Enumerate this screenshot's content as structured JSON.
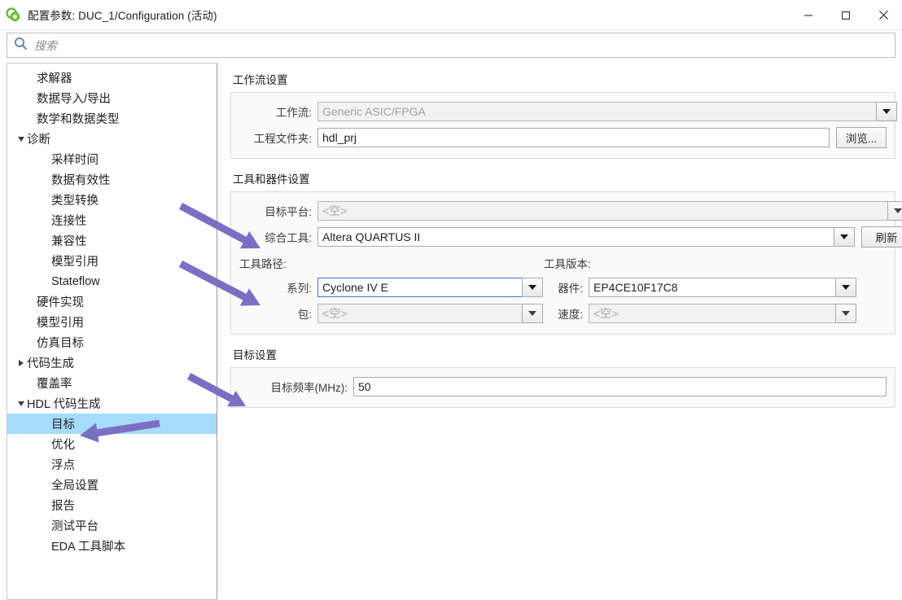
{
  "window": {
    "title": "配置参数: DUC_1/Configuration (活动)",
    "icon": "simulink-icon",
    "minimize": "minimize-icon",
    "maximize": "maximize-icon",
    "close": "close-icon"
  },
  "search": {
    "icon": "search-icon",
    "placeholder": "搜索",
    "value": ""
  },
  "sidebar": {
    "items": [
      {
        "label": "求解器",
        "indent": 1,
        "twisty": "none",
        "selected": false
      },
      {
        "label": "数据导入/导出",
        "indent": 1,
        "twisty": "none",
        "selected": false
      },
      {
        "label": "数学和数据类型",
        "indent": 1,
        "twisty": "none",
        "selected": false
      },
      {
        "label": "诊断",
        "indent": 0,
        "twisty": "expanded",
        "selected": false
      },
      {
        "label": "采样时间",
        "indent": 2,
        "twisty": "none",
        "selected": false
      },
      {
        "label": "数据有效性",
        "indent": 2,
        "twisty": "none",
        "selected": false
      },
      {
        "label": "类型转换",
        "indent": 2,
        "twisty": "none",
        "selected": false
      },
      {
        "label": "连接性",
        "indent": 2,
        "twisty": "none",
        "selected": false
      },
      {
        "label": "兼容性",
        "indent": 2,
        "twisty": "none",
        "selected": false
      },
      {
        "label": "模型引用",
        "indent": 2,
        "twisty": "none",
        "selected": false
      },
      {
        "label": "Stateflow",
        "indent": 2,
        "twisty": "none",
        "selected": false
      },
      {
        "label": "硬件实现",
        "indent": 1,
        "twisty": "none",
        "selected": false
      },
      {
        "label": "模型引用",
        "indent": 1,
        "twisty": "none",
        "selected": false
      },
      {
        "label": "仿真目标",
        "indent": 1,
        "twisty": "none",
        "selected": false
      },
      {
        "label": "代码生成",
        "indent": 0,
        "twisty": "collapsed",
        "selected": false
      },
      {
        "label": "覆盖率",
        "indent": 1,
        "twisty": "none",
        "selected": false
      },
      {
        "label": "HDL 代码生成",
        "indent": 0,
        "twisty": "expanded",
        "selected": false
      },
      {
        "label": "目标",
        "indent": 2,
        "twisty": "none",
        "selected": true
      },
      {
        "label": "优化",
        "indent": 2,
        "twisty": "none",
        "selected": false
      },
      {
        "label": "浮点",
        "indent": 2,
        "twisty": "none",
        "selected": false
      },
      {
        "label": "全局设置",
        "indent": 2,
        "twisty": "none",
        "selected": false
      },
      {
        "label": "报告",
        "indent": 2,
        "twisty": "none",
        "selected": false
      },
      {
        "label": "测试平台",
        "indent": 2,
        "twisty": "none",
        "selected": false
      },
      {
        "label": "EDA 工具脚本",
        "indent": 2,
        "twisty": "none",
        "selected": false
      }
    ]
  },
  "main": {
    "workflow_group": {
      "title": "工作流设置",
      "workflow_label": "工作流:",
      "workflow_value": "Generic ASIC/FPGA",
      "project_folder_label": "工程文件夹:",
      "project_folder_value": "hdl_prj",
      "browse_label": "浏览..."
    },
    "tool_group": {
      "title": "工具和器件设置",
      "target_platform_label": "目标平台:",
      "target_platform_value": "<空>",
      "synthesis_tool_label": "综合工具:",
      "synthesis_tool_value": "Altera QUARTUS II",
      "refresh_label": "刷新",
      "tool_path_label": "工具路径:",
      "tool_version_label": "工具版本:",
      "family_label": "系列:",
      "family_value": "Cyclone IV E",
      "device_label": "器件:",
      "device_value": "EP4CE10F17C8",
      "package_label": "包:",
      "package_value": "<空>",
      "speed_label": "速度:",
      "speed_value": "<空>"
    },
    "target_group": {
      "title": "目标设置",
      "frequency_label": "目标频率(MHz):",
      "frequency_value": "50"
    }
  },
  "annotations": {
    "arrow_color": "#7b6fc4",
    "arrows": [
      {
        "name": "arrow-to-synthesis-tool"
      },
      {
        "name": "arrow-to-family"
      },
      {
        "name": "arrow-to-target-frequency"
      },
      {
        "name": "arrow-to-sidebar-target"
      }
    ]
  },
  "colors": {
    "selection": "#a6dbfb",
    "panel_bg": "#fafafa",
    "accent": "#3a73c8"
  }
}
